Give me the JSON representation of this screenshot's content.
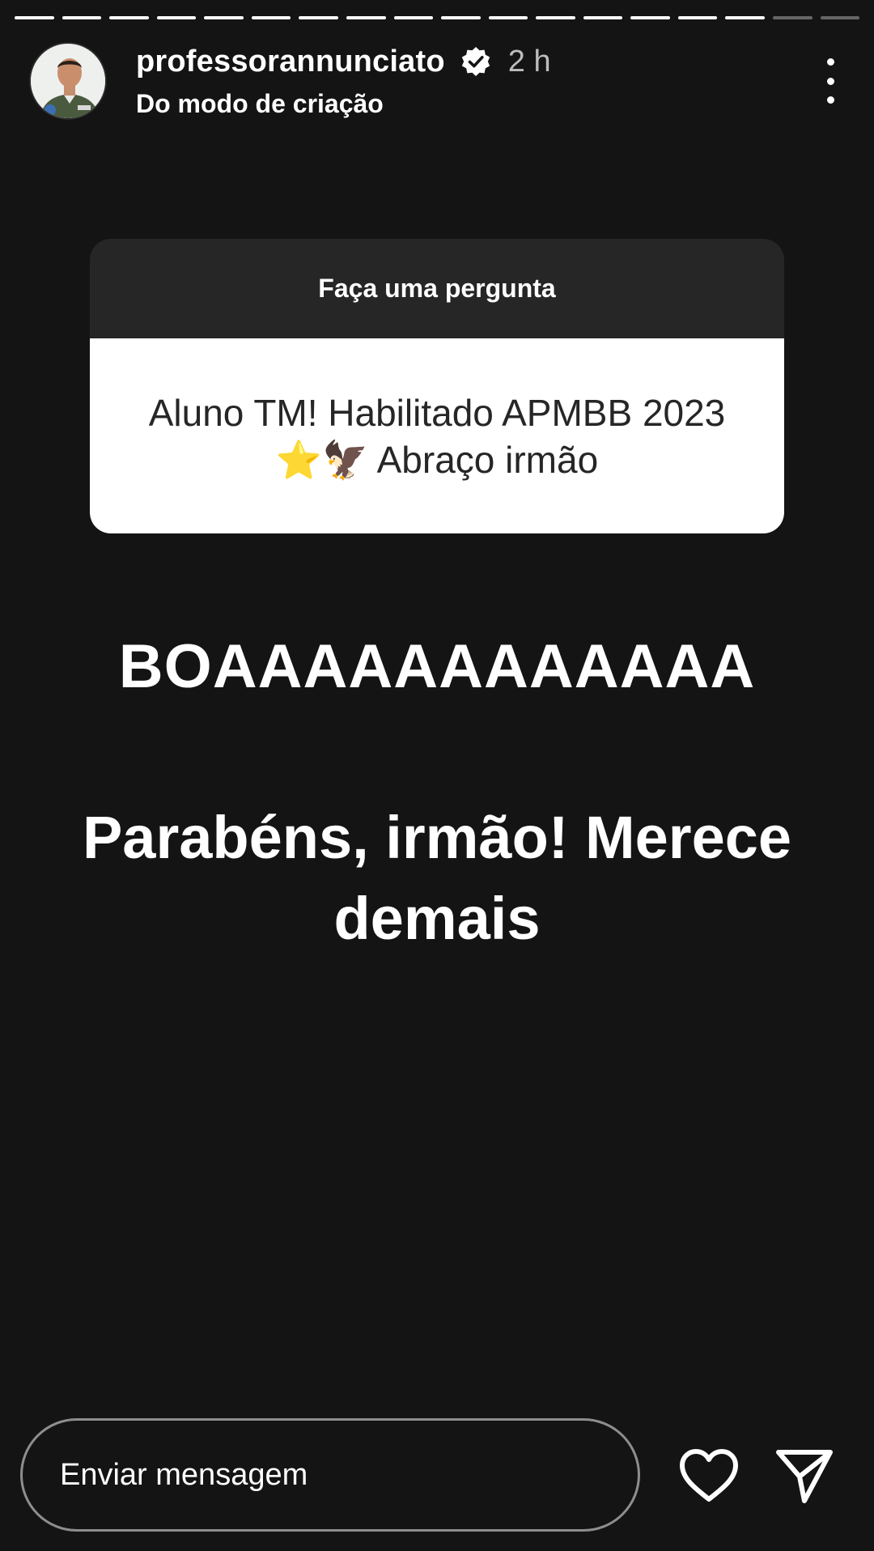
{
  "story": {
    "progress": {
      "total_segments": 18,
      "completed_segments": 16
    },
    "header": {
      "username": "professorannunciato",
      "verified": true,
      "time": "2 h",
      "subtitle": "Do modo de criação"
    },
    "question_sticker": {
      "title": "Faça uma pergunta",
      "answer": "Aluno TM! Habilitado APMBB 2023 ⭐🦅 Abraço irmão"
    },
    "text_lines": {
      "line1": "BOAAAAAAAAAAAA",
      "line2": "Parabéns, irmão! Merece demais"
    },
    "footer": {
      "message_placeholder": "Enviar mensagem"
    },
    "icons": {
      "more": "more-vertical-icon",
      "verified": "verified-badge-icon",
      "like": "heart-icon",
      "send": "send-icon"
    },
    "colors": {
      "background": "#141414",
      "card_header": "#262626",
      "card_body": "#ffffff",
      "verified_badge": "#ffffff"
    }
  }
}
